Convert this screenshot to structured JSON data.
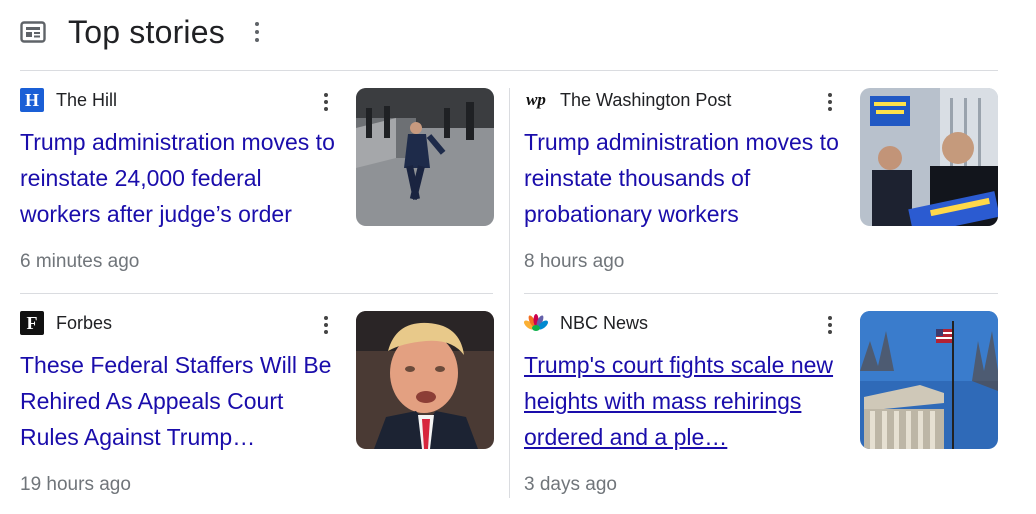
{
  "header": {
    "title": "Top stories",
    "icon": "newspaper-icon"
  },
  "stories": [
    {
      "source": "The Hill",
      "logo_text": "H",
      "logo_icon": "the-hill-logo",
      "headline": "Trump administration moves to reinstate 24,000 federal workers after judge’s order",
      "time": "6 minutes ago",
      "thumb": "photo-man-walking-capitol"
    },
    {
      "source": "The Washington Post",
      "logo_text": "wp",
      "logo_icon": "washington-post-logo",
      "headline": "Trump administration moves to reinstate thousands of probationary workers",
      "time": "8 hours ago",
      "thumb": "photo-protest-signs"
    },
    {
      "source": "Forbes",
      "logo_text": "F",
      "logo_icon": "forbes-logo",
      "headline": "These Federal Staffers Will Be Rehired As Appeals Court Rules Against Trump…",
      "time": "19 hours ago",
      "thumb": "photo-trump-portrait"
    },
    {
      "source": "NBC News",
      "logo_text": "",
      "logo_icon": "nbc-peacock-logo",
      "headline": "Trump's court fights scale new heights with mass rehirings ordered and a ple…",
      "time": "3 days ago",
      "thumb": "photo-supreme-court-flag"
    }
  ],
  "colors": {
    "link": "#1a0dab",
    "meta": "#70757a",
    "divider": "#dadce0",
    "hill_blue": "#1a5fd6"
  }
}
